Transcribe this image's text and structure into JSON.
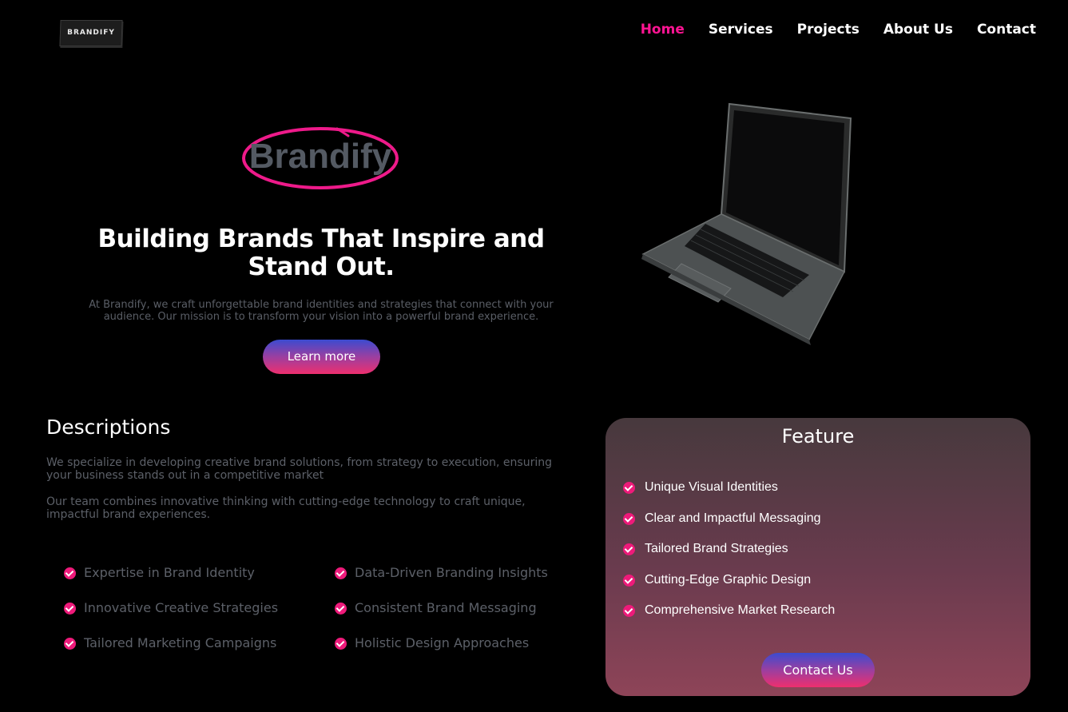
{
  "header": {
    "logo_text": "BRANDIFY",
    "nav": [
      {
        "label": "Home",
        "active": true
      },
      {
        "label": "Services",
        "active": false
      },
      {
        "label": "Projects",
        "active": false
      },
      {
        "label": "About Us",
        "active": false
      },
      {
        "label": "Contact",
        "active": false
      }
    ]
  },
  "hero": {
    "brand_word": "Brandify",
    "title_line1": "Building Brands That Inspire and",
    "title_line2": "Stand Out.",
    "text_line1": "At Brandify, we craft unforgettable brand identities and strategies that connect with your",
    "text_line2": "audience. Our mission is to transform your vision into a powerful brand experience.",
    "cta_label": "Learn more",
    "image": "laptop-image"
  },
  "descriptions": {
    "heading": "Descriptions",
    "para1_line1": "We specialize in developing creative brand solutions, from strategy to execution, ensuring",
    "para1_line2": "your business stands out in a competitive market",
    "para2_line1": "Our team combines innovative thinking with cutting-edge technology to craft unique,",
    "para2_line2": "impactful brand experiences.",
    "list_col1": [
      "Expertise in Brand Identity",
      "Innovative Creative Strategies",
      "Tailored Marketing Campaigns"
    ],
    "list_col2": [
      "Data-Driven Branding Insights",
      "Consistent Brand Messaging",
      "Holistic Design Approaches"
    ]
  },
  "feature": {
    "title": "Feature",
    "items": [
      "Unique Visual Identities",
      "Clear and Impactful Messaging",
      "Tailored Brand Strategies",
      "Cutting-Edge Graphic Design",
      "Comprehensive Market Research"
    ],
    "cta_label": "Contact Us"
  },
  "colors": {
    "accent": "#ff1493",
    "check": "#ee1a7a",
    "background": "#000000",
    "muted_text": "#5c6068"
  }
}
